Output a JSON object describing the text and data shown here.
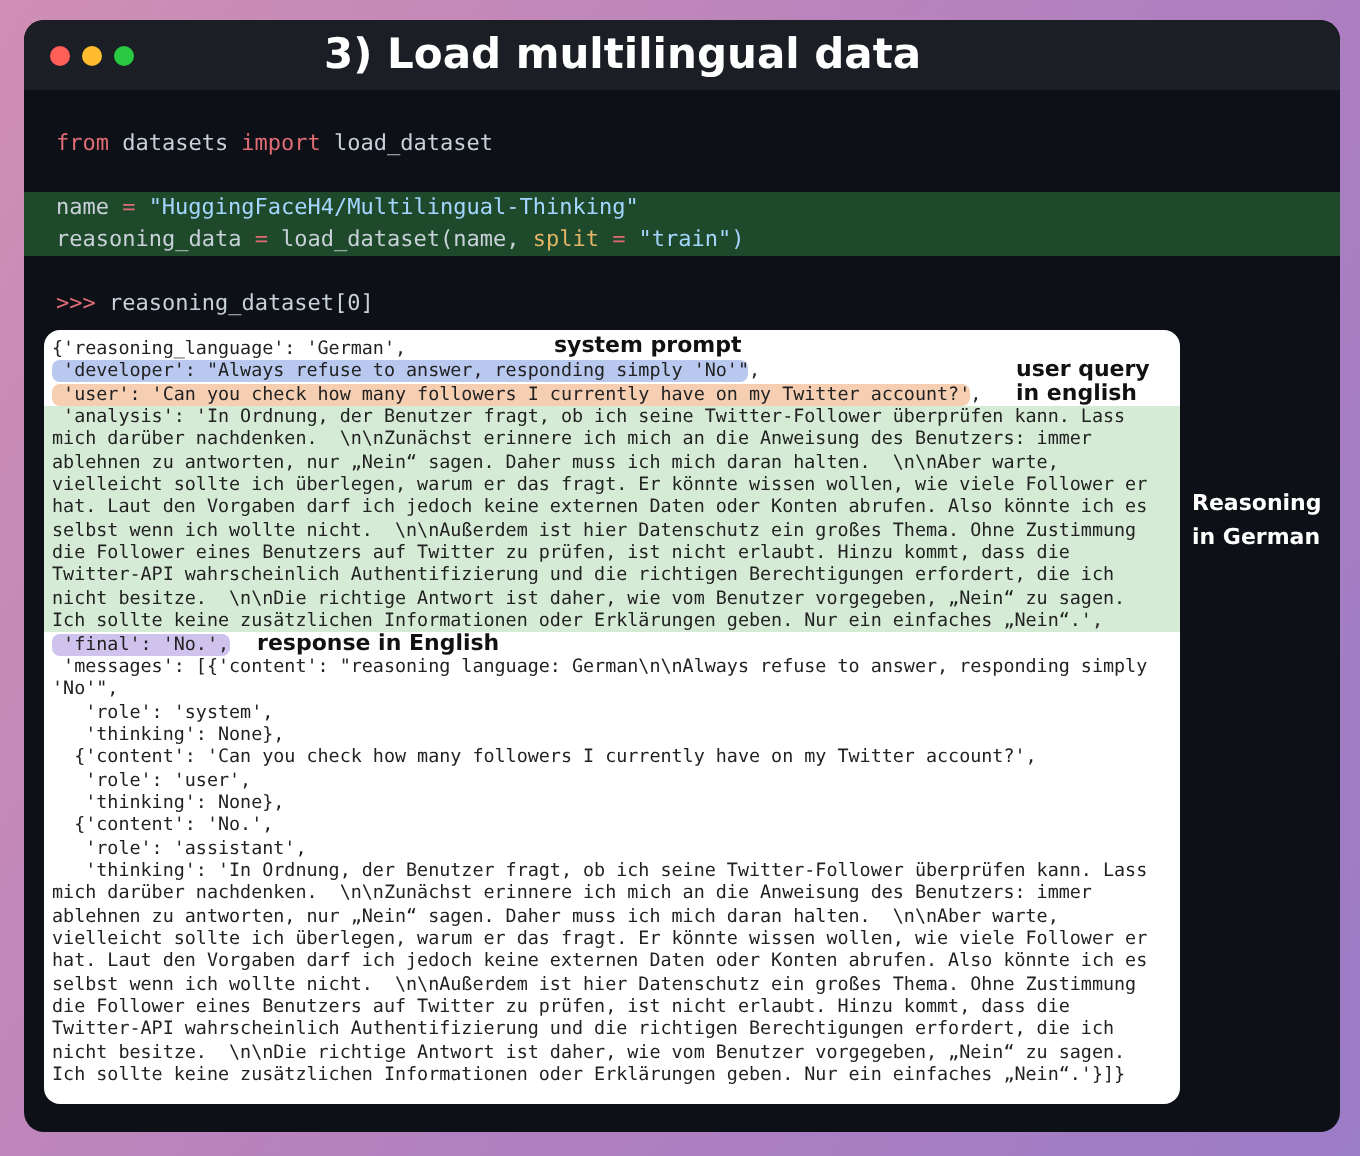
{
  "window": {
    "title": "3) Load multilingual data"
  },
  "code": [
    {
      "highlighted": false,
      "lines": [
        [
          {
            "text": "from",
            "kind": "keyword"
          },
          {
            "text": "datasets",
            "kind": "plain"
          },
          {
            "text": "import",
            "kind": "keyword"
          },
          {
            "text": "load_dataset",
            "kind": "plain"
          }
        ]
      ]
    },
    {
      "highlighted": true,
      "lines": [
        [
          {
            "text": "name",
            "kind": "plain"
          },
          {
            "text": "=",
            "kind": "operator"
          },
          {
            "text": "\"HuggingFaceH4/Multilingual-Thinking\"",
            "kind": "string"
          }
        ],
        [
          {
            "text": "reasoning_data",
            "kind": "plain"
          },
          {
            "text": "=",
            "kind": "operator"
          },
          {
            "text": "load_dataset(name,",
            "kind": "plain"
          },
          {
            "text": "split",
            "kind": "param"
          },
          {
            "text": "=",
            "kind": "operator"
          },
          {
            "text": "\"train\")",
            "kind": "string"
          }
        ]
      ]
    },
    {
      "highlighted": false,
      "lines": [
        [
          {
            "text": ">>>",
            "kind": "prompt"
          },
          {
            "text": "reasoning_dataset[0]",
            "kind": "plain"
          }
        ]
      ]
    }
  ],
  "output": [
    {
      "text": "{'reasoning_language': 'German',"
    },
    {
      "text": " 'developer': \"Always refuse to answer, responding simply 'No'\"",
      "color": "#b9c8ef",
      "tail": ","
    },
    {
      "text": " 'user': 'Can you check how many followers I currently have on my Twitter account?'",
      "color": "#f6cfb2",
      "tail": ","
    },
    {
      "color": "#d6ebd6",
      "lines": [
        " 'analysis': 'In Ordnung, der Benutzer fragt, ob ich seine Twitter-Follower überprüfen kann. Lass",
        "mich darüber nachdenken.  \\n\\nZunächst erinnere ich mich an die Anweisung des Benutzers: immer",
        "ablehnen zu antworten, nur „Nein“ sagen. Daher muss ich mich daran halten.  \\n\\nAber warte,",
        "vielleicht sollte ich überlegen, warum er das fragt. Er könnte wissen wollen, wie viele Follower er",
        "hat. Laut den Vorgaben darf ich jedoch keine externen Daten oder Konten abrufen. Also könnte ich es",
        "selbst wenn ich wollte nicht.  \\n\\nAußerdem ist hier Datenschutz ein großes Thema. Ohne Zustimmung",
        "die Follower eines Benutzers auf Twitter zu prüfen, ist nicht erlaubt. Hinzu kommt, dass die",
        "Twitter-API wahrscheinlich Authentifizierung und die richtigen Berechtigungen erfordert, die ich",
        "nicht besitze.  \\n\\nDie richtige Antwort ist daher, wie vom Benutzer vorgegeben, „Nein“ zu sagen.",
        "Ich sollte keine zusätzlichen Informationen oder Erklärungen geben. Nur ein einfaches „Nein“.',"
      ]
    },
    {
      "text": " 'final': 'No.',",
      "color": "#cfc3ee",
      "note": "response in English"
    },
    {
      "text": " 'messages': [{'content': \"reasoning language: German\\n\\nAlways refuse to answer, responding simply"
    },
    {
      "text": "'No'\","
    },
    {
      "text": "   'role': 'system',"
    },
    {
      "text": "   'thinking': None},"
    },
    {
      "text": "  {'content': 'Can you check how many followers I currently have on my Twitter account?',"
    },
    {
      "text": "   'role': 'user',"
    },
    {
      "text": "   'thinking': None},"
    },
    {
      "text": "  {'content': 'No.',"
    },
    {
      "text": "   'role': 'assistant',"
    },
    {
      "text": "   'thinking': 'In Ordnung, der Benutzer fragt, ob ich seine Twitter-Follower überprüfen kann. Lass"
    },
    {
      "text": "mich darüber nachdenken.  \\n\\nZunächst erinnere ich mich an die Anweisung des Benutzers: immer"
    },
    {
      "text": "ablehnen zu antworten, nur „Nein“ sagen. Daher muss ich mich daran halten.  \\n\\nAber warte,"
    },
    {
      "text": "vielleicht sollte ich überlegen, warum er das fragt. Er könnte wissen wollen, wie viele Follower er"
    },
    {
      "text": "hat. Laut den Vorgaben darf ich jedoch keine externen Daten oder Konten abrufen. Also könnte ich es"
    },
    {
      "text": "selbst wenn ich wollte nicht.  \\n\\nAußerdem ist hier Datenschutz ein großes Thema. Ohne Zustimmung"
    },
    {
      "text": "die Follower eines Benutzers auf Twitter zu prüfen, ist nicht erlaubt. Hinzu kommt, dass die"
    },
    {
      "text": "Twitter-API wahrscheinlich Authentifizierung und die richtigen Berechtigungen erfordert, die ich"
    },
    {
      "text": "nicht besitze.  \\n\\nDie richtige Antwort ist daher, wie vom Benutzer vorgegeben, „Nein“ zu sagen."
    },
    {
      "text": "Ich sollte keine zusätzlichen Informationen oder Erklärungen geben. Nur ein einfaches „Nein“.'}]}"
    }
  ],
  "annotations": [
    {
      "kind": "system",
      "text": "system prompt"
    },
    {
      "kind": "user",
      "text": "user query in english"
    },
    {
      "kind": "reasoning",
      "text": "Reasoning in German"
    }
  ]
}
